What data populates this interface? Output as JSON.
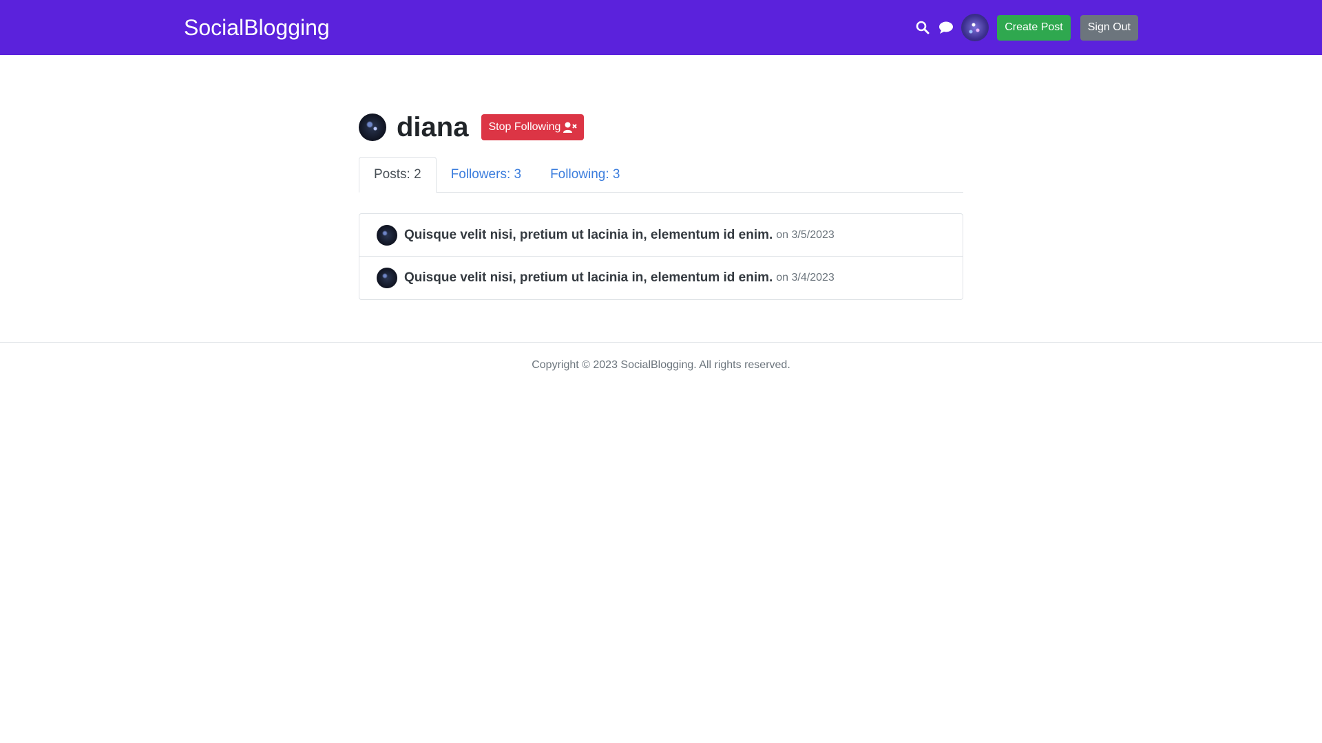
{
  "header": {
    "brand": "SocialBlogging",
    "search_icon": "search-icon",
    "chat_icon": "chat-icon",
    "create_post_label": "Create Post",
    "sign_out_label": "Sign Out",
    "color": "#5b22dc"
  },
  "profile": {
    "username": "diana",
    "unfollow_label": "Stop Following",
    "unfollow_icon": "user-times-icon",
    "tabs": [
      {
        "label": "Posts: 2",
        "active": true
      },
      {
        "label": "Followers: 3",
        "active": false
      },
      {
        "label": "Following: 3",
        "active": false
      }
    ],
    "posts": [
      {
        "title": "Quisque velit nisi, pretium ut lacinia in, elementum id enim.",
        "date": "on 3/5/2023"
      },
      {
        "title": "Quisque velit nisi, pretium ut lacinia in, elementum id enim.",
        "date": "on 3/4/2023"
      }
    ]
  },
  "footer": {
    "text": "Copyright © 2023 SocialBlogging. All rights reserved."
  },
  "colors": {
    "create_post": "#2fa84f",
    "sign_out": "#6c757d",
    "unfollow": "#dc3545",
    "link": "#3b7ddd"
  }
}
